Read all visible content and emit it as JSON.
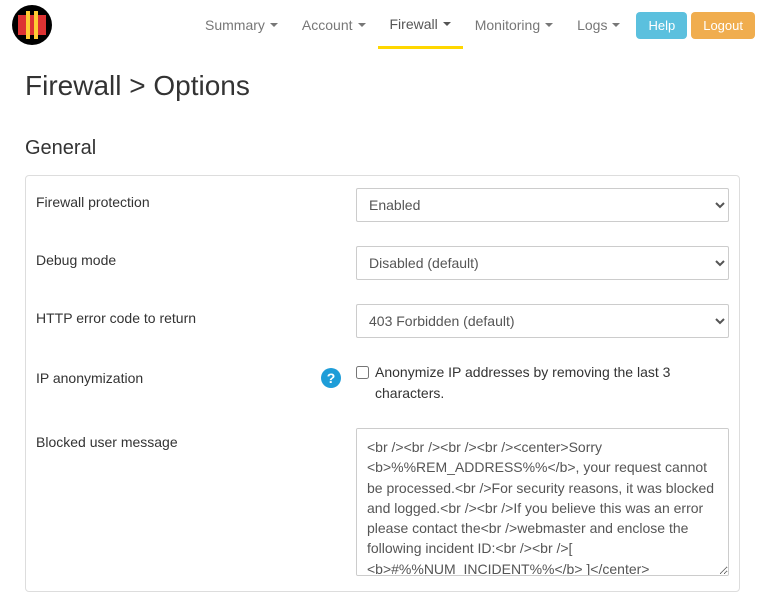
{
  "nav": {
    "items": [
      "Summary",
      "Account",
      "Firewall",
      "Monitoring",
      "Logs"
    ],
    "active_index": 2,
    "help_label": "Help",
    "logout_label": "Logout"
  },
  "page_title": "Firewall > Options",
  "section_general_title": "General",
  "fields": {
    "firewall_protection": {
      "label": "Firewall protection",
      "value": "Enabled"
    },
    "debug_mode": {
      "label": "Debug mode",
      "value": "Disabled (default)"
    },
    "http_error": {
      "label": "HTTP error code to return",
      "value": "403 Forbidden (default)"
    },
    "ip_anon": {
      "label": "IP anonymization",
      "checkbox_text": "Anonymize IP addresses by removing the last 3 characters."
    },
    "blocked_msg": {
      "label": "Blocked user message",
      "value": "<br /><br /><br /><br /><center>Sorry <b>%%REM_ADDRESS%%</b>, your request cannot be processed.<br />For security reasons, it was blocked and logged.<br /><br />If you believe this was an error please contact the<br />webmaster and enclose the following incident ID:<br /><br />[ <b>#%%NUM_INCIDENT%%</b> ]</center>"
    }
  }
}
